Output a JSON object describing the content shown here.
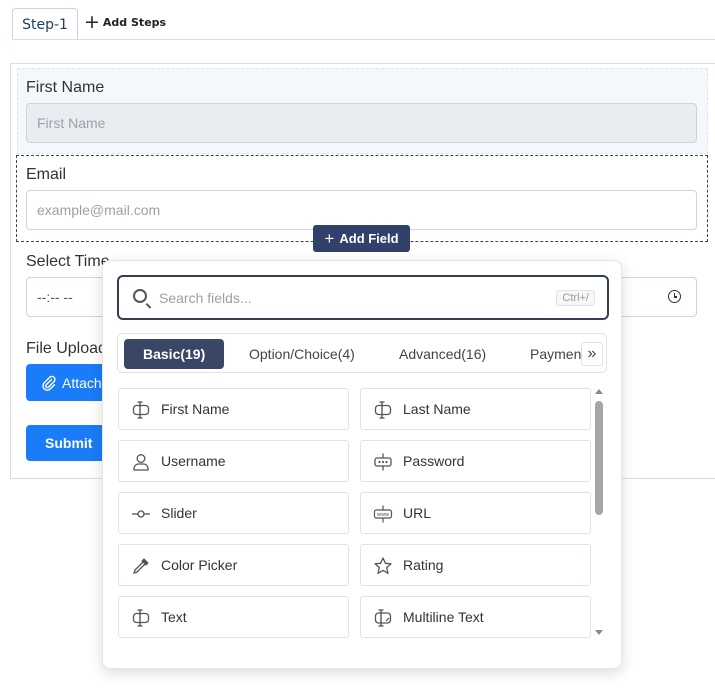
{
  "steps": {
    "tabs": [
      {
        "label": "Step-1"
      }
    ],
    "add_steps_label": "Add Steps"
  },
  "form": {
    "first_name": {
      "label": "First Name",
      "placeholder": "First Name"
    },
    "email": {
      "label": "Email",
      "placeholder": "example@mail.com"
    },
    "select_time": {
      "label": "Select Time",
      "value": "--:-- --"
    },
    "file_upload": {
      "label": "File Upload",
      "attach_label": "Attach"
    },
    "submit_label": "Submit",
    "add_field_label": "Add Field"
  },
  "popup": {
    "search_placeholder": "Search fields...",
    "shortcut": "Ctrl+/",
    "tabs": [
      {
        "label": "Basic(19)",
        "active": true
      },
      {
        "label": "Option/Choice(4)"
      },
      {
        "label": "Advanced(16)"
      },
      {
        "label": "Payment"
      }
    ],
    "more_icon": "double-chevron-right",
    "fields": [
      {
        "label": "First Name",
        "icon": "text-cursor-icon"
      },
      {
        "label": "Last Name",
        "icon": "text-cursor-icon"
      },
      {
        "label": "Username",
        "icon": "user-icon"
      },
      {
        "label": "Password",
        "icon": "password-icon"
      },
      {
        "label": "Slider",
        "icon": "slider-icon"
      },
      {
        "label": "URL",
        "icon": "url-icon"
      },
      {
        "label": "Color Picker",
        "icon": "eyedropper-icon"
      },
      {
        "label": "Rating",
        "icon": "star-icon"
      },
      {
        "label": "Text",
        "icon": "text-cursor-icon"
      },
      {
        "label": "Multiline Text",
        "icon": "multiline-text-icon"
      }
    ]
  },
  "colors": {
    "primary": "#1a7cf9",
    "navy": "#32416b",
    "tab_active": "#3b4666"
  }
}
